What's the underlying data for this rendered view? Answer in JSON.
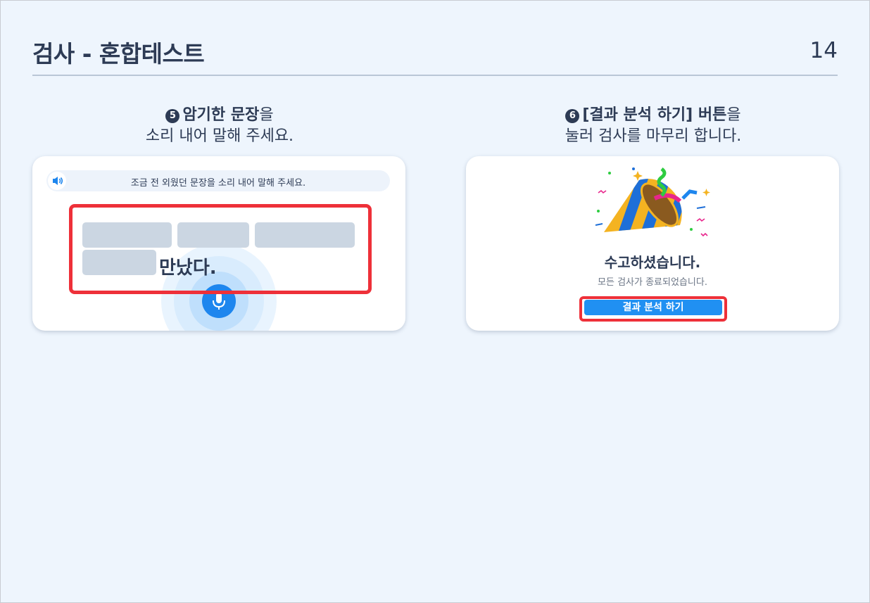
{
  "header": {
    "title": "검사 - 혼합테스트",
    "page_number": "14"
  },
  "step5": {
    "number": "5",
    "line1_strong": "암기한 문장",
    "line1_rest": "을",
    "line2": "소리 내어 말해 주세요.",
    "prompt_text": "조금 전 외웠던 문장을 소리 내어 말해 주세요.",
    "answer_word": "만났다."
  },
  "step6": {
    "number": "6",
    "line1_strong": "[결과 분석 하기] 버튼",
    "line1_rest": "을",
    "line2": "눌러 검사를 마무리 합니다.",
    "done_title": "수고하셨습니다.",
    "done_sub": "모든 검사가 종료되었습니다.",
    "button_label": "결과 분석 하기"
  },
  "colors": {
    "accent": "#1e86ee",
    "highlight": "#ee3039",
    "blank": "#cbd6e2",
    "text": "#2d3b55"
  },
  "icons": {
    "speaker": "speaker-icon",
    "mic": "microphone-icon",
    "party": "party-popper-icon"
  }
}
